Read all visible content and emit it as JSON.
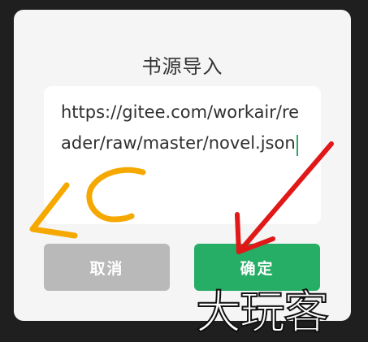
{
  "dialog": {
    "title": "书源导入",
    "input": {
      "value": "https://gitee.com/workair/reader/raw/master/novel.json"
    },
    "cancel_label": "取消",
    "confirm_label": "确定"
  },
  "watermark": {
    "text": "大玩客"
  },
  "colors": {
    "confirm": "#26ad66",
    "cancel": "#b9b9b9",
    "dialog_bg": "#f5f5f5",
    "orange_annotation": "#f5a800",
    "red_annotation": "#e01818"
  }
}
